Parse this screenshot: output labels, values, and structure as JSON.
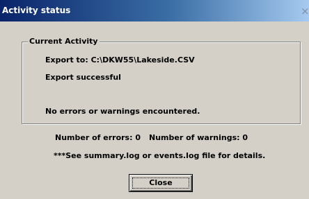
{
  "window": {
    "title": "Activity status",
    "close_glyph": "×"
  },
  "group": {
    "label": "Current Activity",
    "export_line": "Export to: C:\\DKW55\\Lakeside.CSV",
    "status_line": "Export successful",
    "errors_line": "No errors or warnings encountered."
  },
  "summary": {
    "errors_count": "Number of errors: 0",
    "warnings_count": "Number of warnings: 0",
    "details_note": "***See summary.log or events.log file for details."
  },
  "buttons": {
    "close_label": "Close"
  },
  "colors": {
    "title_start": "#0a246a",
    "title_end": "#a6caf0",
    "face": "#d4d0c8"
  }
}
